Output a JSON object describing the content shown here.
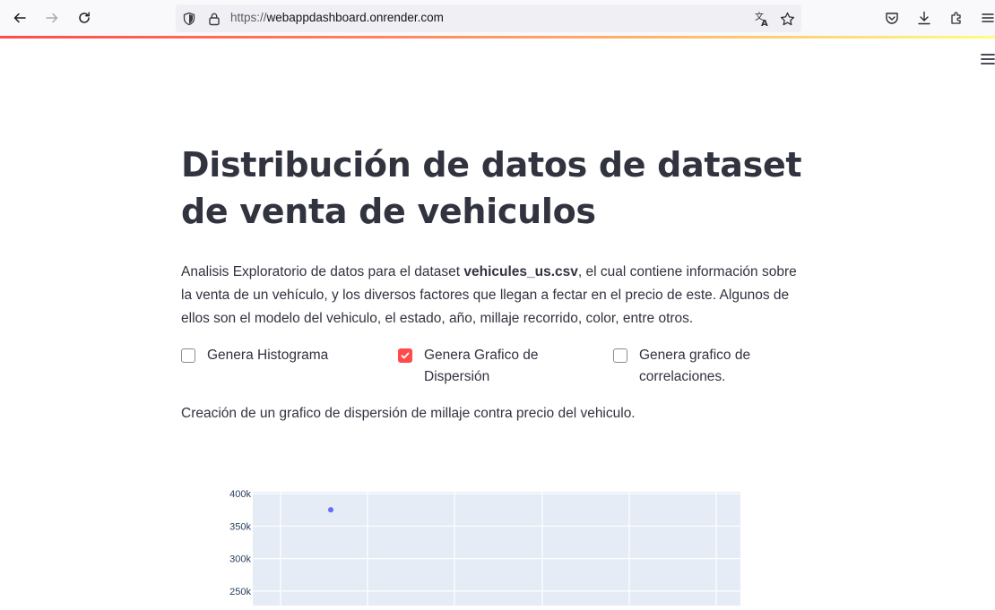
{
  "browser": {
    "url_scheme": "https://",
    "url_host": "webappdashboard.onrender.com"
  },
  "page": {
    "title": "Distribución de datos de dataset de venta de vehiculos",
    "intro_before": "Analisis Exploratorio de datos para el dataset ",
    "intro_bold": "vehicules_us.csv",
    "intro_after": ", el cual contiene información sobre la venta de un vehículo, y los diversos factores que llegan a fectar en el precio de este. Algunos de ellos son el modelo del vehiculo, el estado, año, millaje recorrido, color, entre otros.",
    "checkboxes": [
      {
        "label": "Genera Histograma",
        "checked": false
      },
      {
        "label": "Genera Grafico de Dispersión",
        "checked": true
      },
      {
        "label": "Genera grafico de correlaciones.",
        "checked": false
      }
    ],
    "caption": "Creación de un grafico de dispersión de millaje contra precio del vehiculo."
  },
  "colors": {
    "accent": "#ff4b4b",
    "plot_bg": "#e5ecf6",
    "marker": "#636efa"
  },
  "chart_data": {
    "type": "scatter",
    "title": "",
    "xlabel": "",
    "ylabel": "",
    "y_ticks": [
      "400k",
      "350k",
      "300k",
      "250k"
    ],
    "y_tick_values": [
      400000,
      350000,
      300000,
      250000
    ],
    "ylim_visible": [
      225000,
      400000
    ],
    "points": [
      {
        "x": null,
        "y": 375000
      }
    ]
  }
}
